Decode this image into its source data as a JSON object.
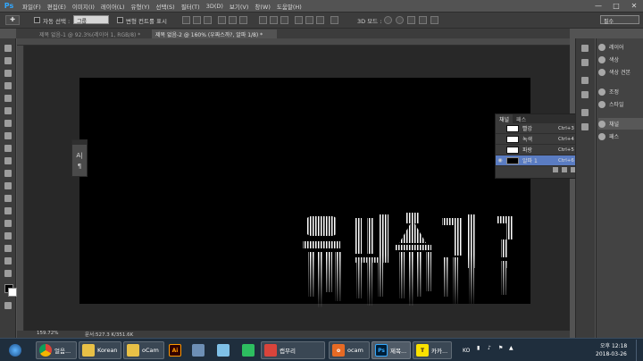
{
  "app": {
    "logo": "Ps",
    "accent": "#31a8ff"
  },
  "menu": [
    "파일(F)",
    "편집(E)",
    "이미지(I)",
    "레이어(L)",
    "유형(Y)",
    "선택(S)",
    "필터(T)",
    "3D(D)",
    "보기(V)",
    "창(W)",
    "도움말(H)"
  ],
  "options": {
    "auto_select_label": "자동 선택 :",
    "auto_select_value": "그룹",
    "transform_label": "변형 컨트롤 표시",
    "mode_3d_label": "3D 모드 :",
    "workspace": "필수"
  },
  "tabs": [
    {
      "label": "제목 없음-1 @ 92.3%(레이어 1, RGB/8) *",
      "active": false
    },
    {
      "label": "제목 없음-2 @ 160% (우짜스까?, 알파 1/8) *",
      "active": true
    }
  ],
  "mini_panel": {
    "icon1": "A|",
    "icon2": "¶"
  },
  "channels_panel": {
    "tabs": [
      "채널",
      "패스"
    ],
    "rows": [
      {
        "name": "빨강",
        "shortcut": "Ctrl+3",
        "selected": false,
        "visible": false
      },
      {
        "name": "녹색",
        "shortcut": "Ctrl+4",
        "selected": false,
        "visible": false
      },
      {
        "name": "파랑",
        "shortcut": "Ctrl+5",
        "selected": false,
        "visible": false
      },
      {
        "name": "알파 1",
        "shortcut": "Ctrl+6",
        "selected": true,
        "visible": true
      }
    ]
  },
  "dock": [
    "레이어",
    "색상",
    "색상 견본",
    "조정",
    "스타일",
    "채널",
    "패스"
  ],
  "status": {
    "zoom": "159.72%",
    "doc": "문서:527.3 K/351.6K"
  },
  "taskbar": {
    "items": [
      {
        "label": "",
        "icon": "windows-start"
      },
      {
        "label": "얼음...",
        "icon": "chrome"
      },
      {
        "label": "Korean",
        "icon": "folder"
      },
      {
        "label": "oCam",
        "icon": "folder"
      },
      {
        "label": "",
        "icon": "illustrator"
      },
      {
        "label": "",
        "icon": "monitor"
      },
      {
        "label": "",
        "icon": "notepad"
      },
      {
        "label": "",
        "icon": "evernote"
      },
      {
        "label": "",
        "icon": "green-app"
      },
      {
        "label": "캡무리",
        "icon": "capture"
      },
      {
        "label": "ocam",
        "icon": "ocam"
      },
      {
        "label": "제목...",
        "icon": "photoshop"
      },
      {
        "label": "카카...",
        "icon": "kakaotalk"
      }
    ],
    "tray_lang": "KO",
    "time": "오후 12:18",
    "date": "2018-03-26"
  }
}
